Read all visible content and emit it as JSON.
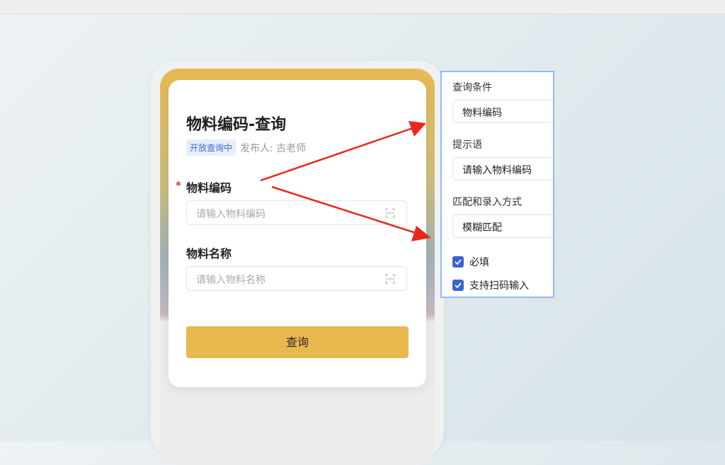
{
  "form": {
    "title": "物料编码-查询",
    "status_tag": "开放查询中",
    "publisher": "发布人: 古老师",
    "required_mark": "*",
    "fields": [
      {
        "label": "物料编码",
        "placeholder": "请输入物料编码",
        "required": true
      },
      {
        "label": "物料名称",
        "placeholder": "请输入物料名称",
        "required": false
      }
    ],
    "submit_label": "查询"
  },
  "config_panel": {
    "query_condition_label": "查询条件",
    "query_condition_value": "物料编码",
    "hint_label": "提示语",
    "hint_value": "请输入物料编码",
    "match_mode_label": "匹配和录入方式",
    "match_mode_value": "模糊匹配",
    "required_checkbox": {
      "label": "必填",
      "checked": true
    },
    "scan_checkbox": {
      "label": "支持扫码输入",
      "checked": true
    }
  },
  "colors": {
    "accent": "#e8b84f",
    "checkbox": "#3b63d6",
    "arrow": "#e8281c",
    "panel_border": "#91b8f8"
  }
}
